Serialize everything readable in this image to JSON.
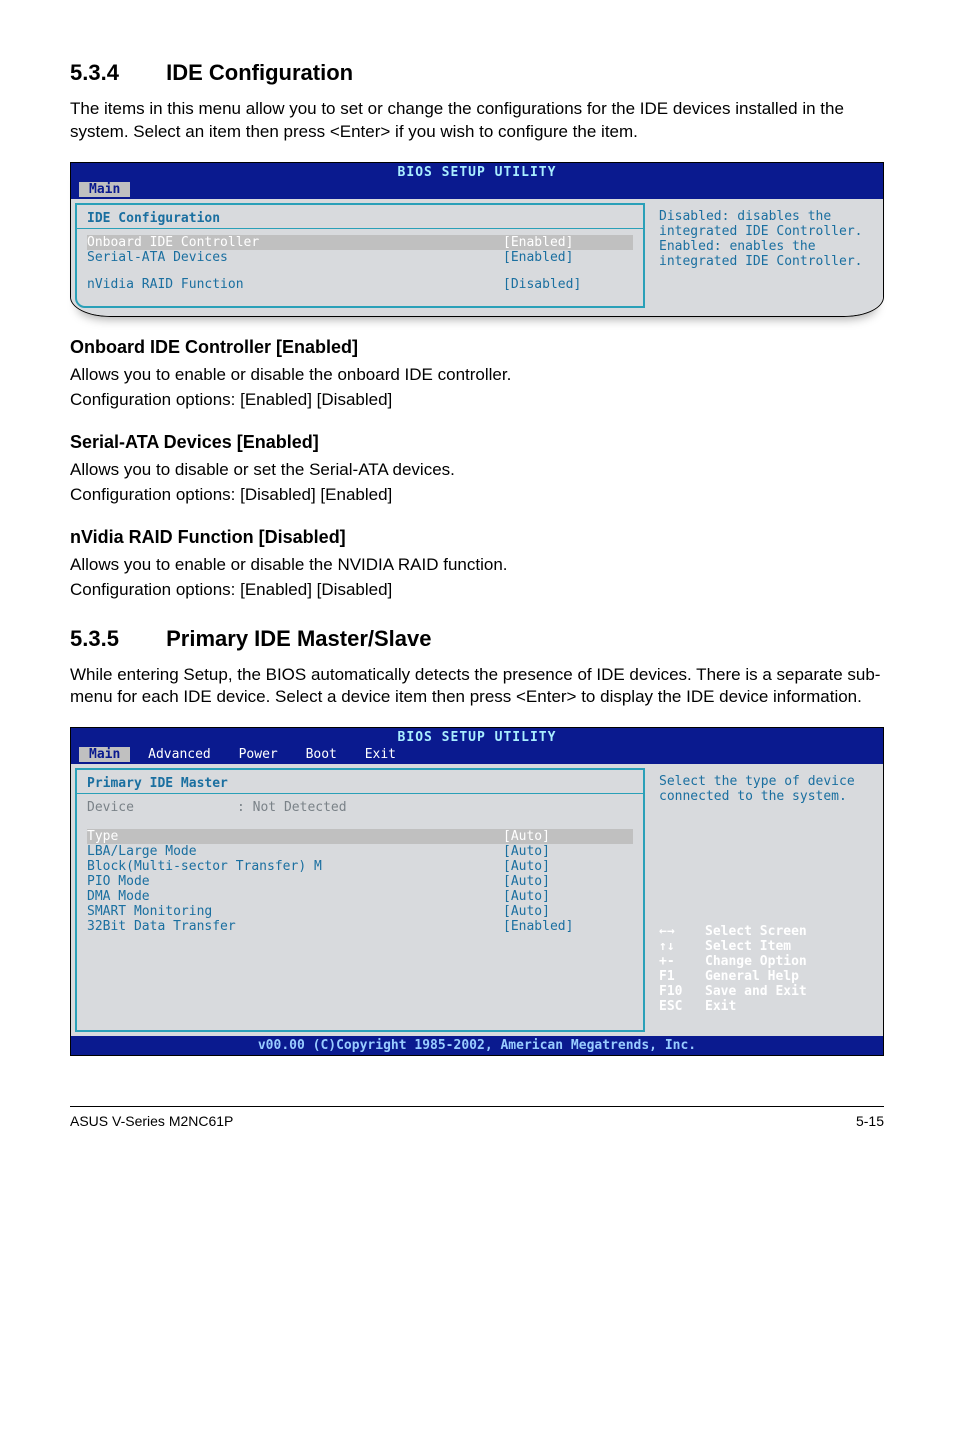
{
  "section1": {
    "number": "5.3.4",
    "title": "IDE Configuration",
    "intro": "The items in this menu allow you to set or change the configurations for the IDE devices installed in the system. Select an item then press <Enter> if you wish to configure the item."
  },
  "bios1": {
    "util_title": "BIOS SETUP UTILITY",
    "tab_main": "Main",
    "panel_title": "IDE Configuration",
    "rows": [
      {
        "label": "Onboard IDE Controller",
        "value": "[Enabled]",
        "sel": true
      },
      {
        "label": "Serial-ATA Devices",
        "value": "[Enabled]",
        "sel": false
      },
      {
        "label": "nVidia RAID Function",
        "value": "[Disabled]",
        "sel": false,
        "gap": true
      }
    ],
    "help": "Disabled: disables the integrated IDE Controller.\nEnabled: enables the integrated IDE Controller."
  },
  "sub1": {
    "title": "Onboard IDE Controller [Enabled]",
    "p1": "Allows you to enable or disable the onboard IDE controller.",
    "p2": "Configuration options: [Enabled] [Disabled]"
  },
  "sub2": {
    "title": "Serial-ATA Devices [Enabled]",
    "p1": "Allows you to disable or set the Serial-ATA devices.",
    "p2": "Configuration options: [Disabled] [Enabled]"
  },
  "sub3": {
    "title": "nVidia RAID Function [Disabled]",
    "p1": "Allows you to enable or disable the NVIDIA RAID function.",
    "p2": "Configuration options: [Enabled] [Disabled]"
  },
  "section2": {
    "number": "5.3.5",
    "title": "Primary IDE Master/Slave",
    "intro": "While entering Setup, the BIOS automatically detects the presence of IDE devices. There is a separate sub-menu for each IDE device. Select a device item then press <Enter> to display the IDE device information."
  },
  "bios2": {
    "util_title": "BIOS SETUP UTILITY",
    "tabs": [
      "Main",
      "Advanced",
      "Power",
      "Boot",
      "Exit"
    ],
    "panel_title": "Primary IDE Master",
    "device_label": "Device",
    "device_value": ": Not Detected",
    "rows": [
      {
        "label": "Type",
        "value": "[Auto]",
        "sel": true
      },
      {
        "label": "LBA/Large Mode",
        "value": "[Auto]"
      },
      {
        "label": "Block(Multi-sector Transfer) M",
        "value": "[Auto]"
      },
      {
        "label": "PIO Mode",
        "value": "[Auto]"
      },
      {
        "label": "DMA Mode",
        "value": "[Auto]"
      },
      {
        "label": "SMART Monitoring",
        "value": "[Auto]"
      },
      {
        "label": "32Bit Data Transfer",
        "value": "[Enabled]"
      }
    ],
    "help": "Select the type of device connected to the system.",
    "keys": [
      {
        "sym": "←→",
        "txt": "Select Screen"
      },
      {
        "sym": "↑↓",
        "txt": "Select Item"
      },
      {
        "sym": "+-",
        "txt": "Change Option"
      },
      {
        "sym": "F1",
        "txt": "General Help"
      },
      {
        "sym": "F10",
        "txt": "Save and Exit"
      },
      {
        "sym": "ESC",
        "txt": "Exit"
      }
    ],
    "footer": "v00.00 (C)Copyright 1985-2002, American Megatrends, Inc."
  },
  "page_footer": {
    "left": "ASUS V-Series M2NC61P",
    "right": "5-15"
  }
}
